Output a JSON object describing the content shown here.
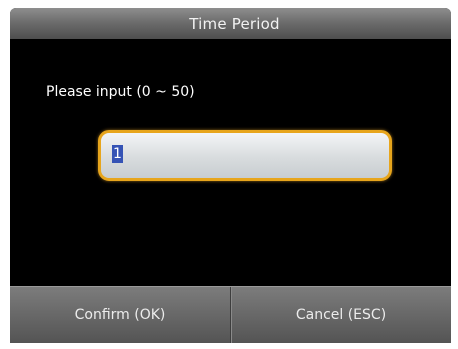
{
  "dialog": {
    "title": "Time Period",
    "prompt": "Please input (0 ~ 50)",
    "input_value": "1"
  },
  "buttons": {
    "confirm_label": "Confirm (OK)",
    "cancel_label": "Cancel (ESC)"
  },
  "colors": {
    "input_border": "#e7a51c",
    "selection_highlight": "#3553b5",
    "screen_background": "#000000"
  }
}
